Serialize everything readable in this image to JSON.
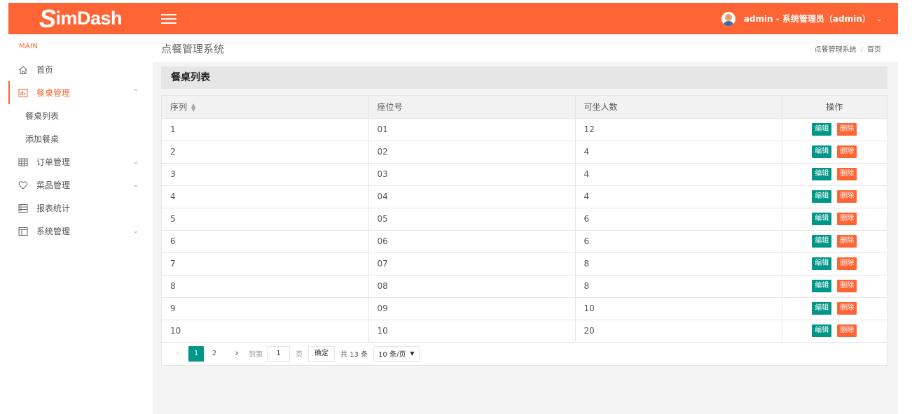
{
  "header": {
    "logo_s": "S",
    "logo_rest": "imDash",
    "user_label": "admin - 系统管理员（admin）"
  },
  "sidebar": {
    "section": "MAIN",
    "items": [
      {
        "label": "首页",
        "icon": "home-icon"
      },
      {
        "label": "餐桌管理",
        "icon": "table-chart-icon",
        "expanded": true,
        "sub": [
          "餐桌列表",
          "添加餐桌"
        ]
      },
      {
        "label": "订单管理",
        "icon": "grid-icon"
      },
      {
        "label": "菜品管理",
        "icon": "heart-icon"
      },
      {
        "label": "报表统计",
        "icon": "report-icon"
      },
      {
        "label": "系统管理",
        "icon": "layout-icon"
      }
    ]
  },
  "page": {
    "title": "点餐管理系统",
    "breadcrumb": [
      "点餐管理系统",
      "首页"
    ]
  },
  "panel": {
    "title": "餐桌列表",
    "columns": [
      "序列",
      "座位号",
      "可坐人数",
      "操作"
    ],
    "edit_label": "编辑",
    "delete_label": "删除",
    "rows": [
      {
        "seq": "1",
        "seat": "01",
        "capacity": "12"
      },
      {
        "seq": "2",
        "seat": "02",
        "capacity": "4"
      },
      {
        "seq": "3",
        "seat": "03",
        "capacity": "4"
      },
      {
        "seq": "4",
        "seat": "04",
        "capacity": "4"
      },
      {
        "seq": "5",
        "seat": "05",
        "capacity": "6"
      },
      {
        "seq": "6",
        "seat": "06",
        "capacity": "6"
      },
      {
        "seq": "7",
        "seat": "07",
        "capacity": "8"
      },
      {
        "seq": "8",
        "seat": "08",
        "capacity": "8"
      },
      {
        "seq": "9",
        "seat": "09",
        "capacity": "10"
      },
      {
        "seq": "10",
        "seat": "10",
        "capacity": "20"
      }
    ]
  },
  "pager": {
    "pages": [
      "1",
      "2"
    ],
    "current": "1",
    "goto_label": "到第",
    "goto_value": "1",
    "page_label": "页",
    "confirm_label": "确定",
    "total_label": "共 13 条",
    "per_page": "10 条/页"
  },
  "colors": {
    "accent": "#fe6434",
    "teal": "#009688"
  }
}
